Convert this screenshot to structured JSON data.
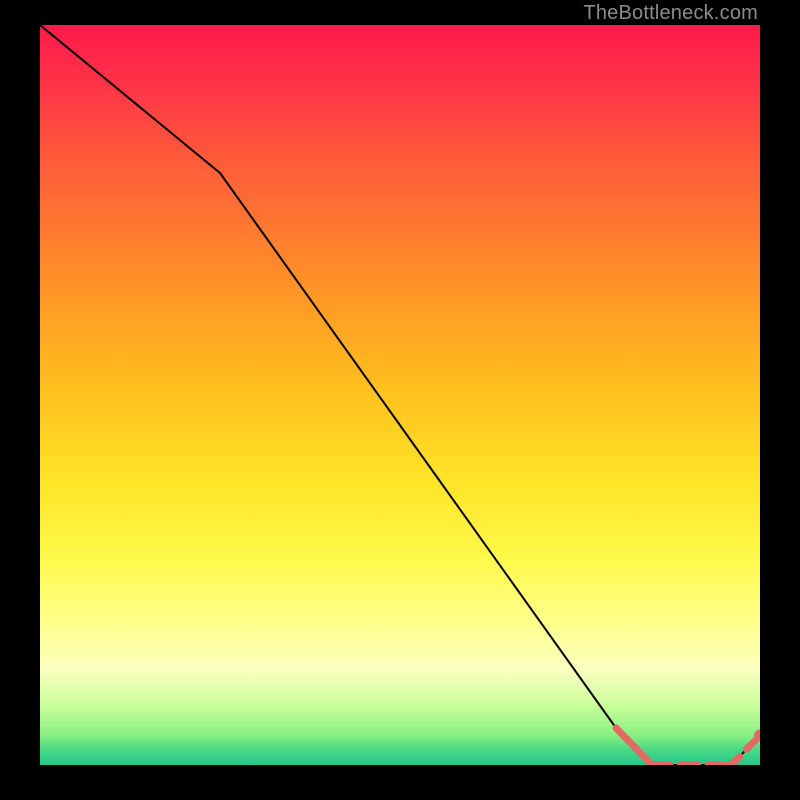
{
  "watermark": "TheBottleneck.com",
  "chart_data": {
    "type": "line",
    "title": "",
    "xlabel": "",
    "ylabel": "",
    "xlim": [
      0,
      100
    ],
    "ylim": [
      0,
      100
    ],
    "series": [
      {
        "name": "main-curve",
        "x": [
          0,
          25,
          80,
          85,
          96,
          100
        ],
        "y": [
          100,
          80,
          5,
          0,
          0,
          4
        ]
      },
      {
        "name": "highlight-segment",
        "x": [
          80,
          85,
          96,
          100
        ],
        "y": [
          5,
          0,
          0,
          4
        ]
      }
    ],
    "colors": {
      "curve": "#000000",
      "highlight": "#e36a62",
      "marker": "#e36a62"
    }
  }
}
